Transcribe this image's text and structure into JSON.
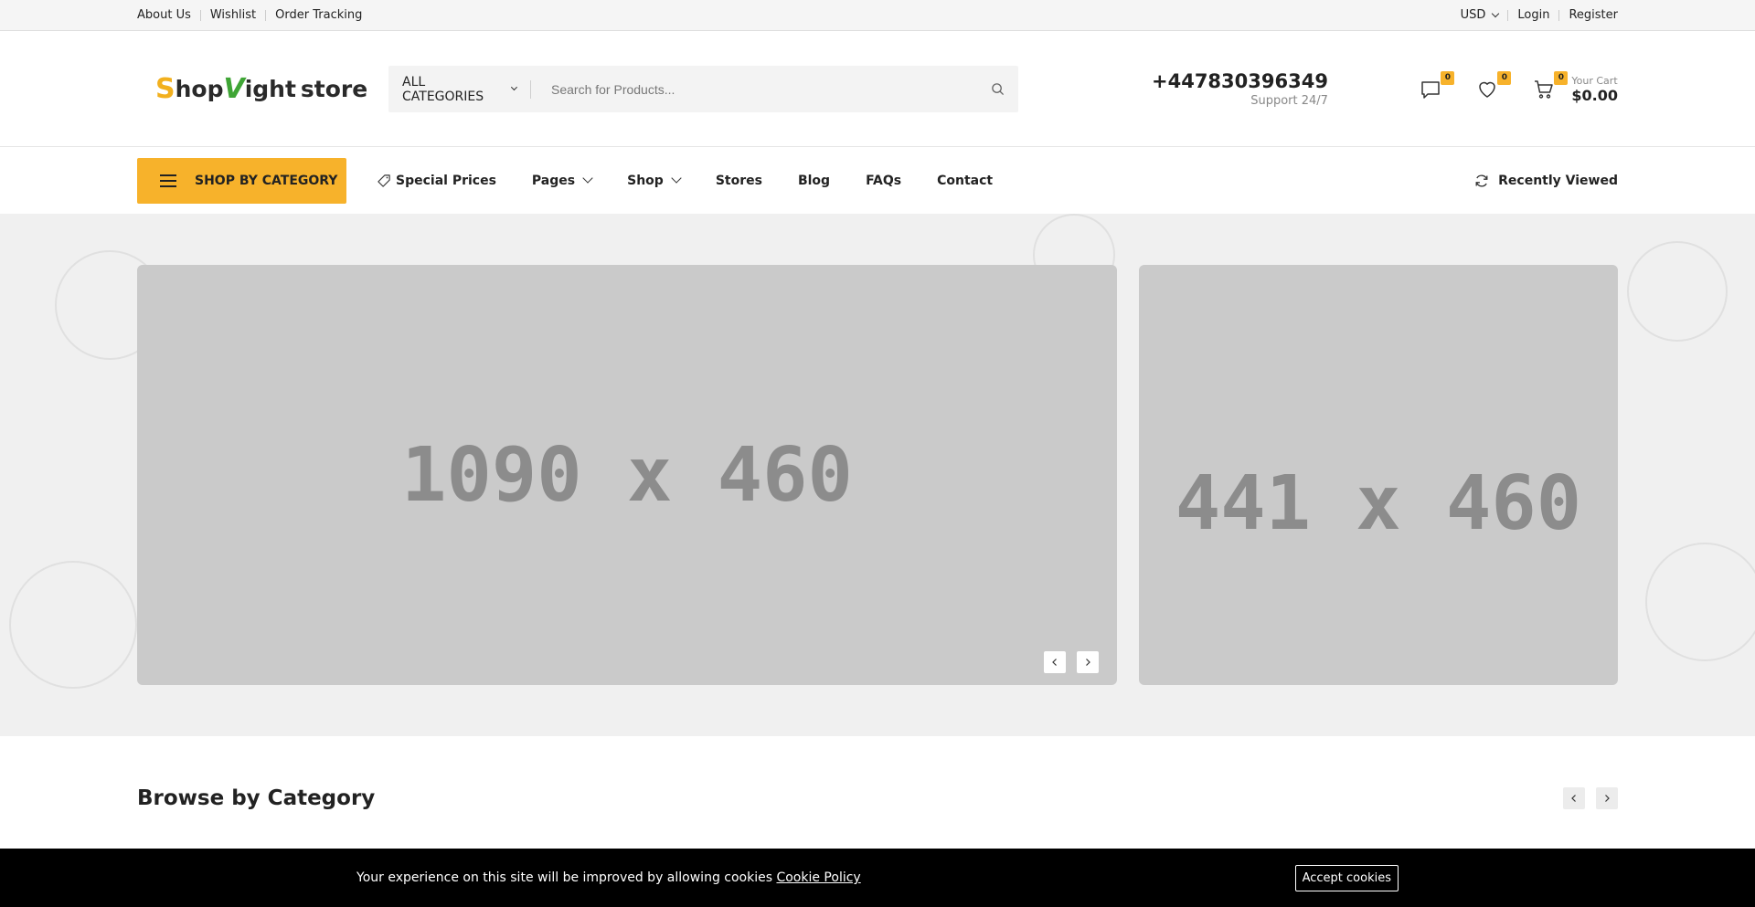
{
  "topbar": {
    "left_links": [
      "About Us",
      "Wishlist",
      "Order Tracking"
    ],
    "currency": "USD",
    "login": "Login",
    "register": "Register"
  },
  "header": {
    "logo": {
      "s": "S",
      "hop": "hop",
      "v": "V",
      "ight": "ight",
      "store": "store"
    },
    "search": {
      "category": "ALL CATEGORIES",
      "placeholder": "Search for Products..."
    },
    "phone": "+447830396349",
    "support": "Support 24/7",
    "compare_count": "0",
    "wishlist_count": "0",
    "cart_count": "0",
    "cart_label": "Your Cart",
    "cart_total": "$0.00"
  },
  "nav": {
    "shop_by_category": "SHOP BY CATEGORY",
    "special_prices": "Special Prices",
    "pages": "Pages",
    "shop": "Shop",
    "stores": "Stores",
    "blog": "Blog",
    "faqs": "FAQs",
    "contact": "Contact",
    "recently_viewed": "Recently Viewed"
  },
  "hero": {
    "main_banner": "1090 x 460",
    "side_banner": "441 x 460"
  },
  "browse": {
    "title": "Browse by Category"
  },
  "cookie": {
    "message": "Your experience on this site will be improved by allowing cookies",
    "policy_link": "Cookie Policy",
    "accept": "Accept cookies"
  }
}
